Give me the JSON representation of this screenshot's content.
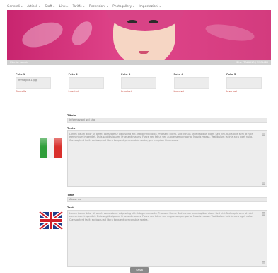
{
  "topnav": {
    "items": [
      {
        "label": "Generali"
      },
      {
        "label": "Articoli"
      },
      {
        "label": "Staff"
      },
      {
        "label": "Link"
      },
      {
        "label": "Tariffe"
      },
      {
        "label": "Recensioni"
      },
      {
        "label": "Photogallery"
      },
      {
        "label": "Impostazioni"
      }
    ]
  },
  "infobar": {
    "left": "Utente: Admin",
    "right": "Sito: ITALIANO / ENGLISH"
  },
  "boxes": [
    {
      "title": "Foto 1",
      "value": "Immagine1.jpg",
      "link": "Cancella"
    },
    {
      "title": "Foto 2",
      "value": "",
      "link": "Inserisci"
    },
    {
      "title": "Foto 3",
      "value": "",
      "link": "Inserisci"
    },
    {
      "title": "Foto 4",
      "value": "",
      "link": "Inserisci"
    },
    {
      "title": "Foto 5",
      "value": "",
      "link": "Inserisci"
    }
  ],
  "italian": {
    "titolo_label": "Titolo",
    "titolo_value": "Informazioni sul sito",
    "testo_label": "Testo",
    "testo_value": "Lorem ipsum dolor sit amet, consectetur adipiscing elit. Integer nec odio. Praesent libero. Sed cursus ante dapibus diam. Sed nisi. Nulla quis sem at nibh elementum imperdiet. Duis sagittis ipsum. Praesent mauris. Fusce nec tellus sed augue semper porta. Mauris massa. Vestibulum lacinia arcu eget nulla. Class aptent taciti sociosqu ad litora torquent per conubia nostra, per inceptos himenaeos."
  },
  "english": {
    "titolo_label": "Title",
    "titolo_value": "About us",
    "testo_label": "Text",
    "testo_value": "Lorem ipsum dolor sit amet, consectetur adipiscing elit. Integer nec odio. Praesent libero. Sed cursus ante dapibus diam. Sed nisi. Nulla quis sem at nibh elementum imperdiet. Duis sagittis ipsum. Praesent mauris. Fusce nec tellus sed augue semper porta. Mauris massa. Vestibulum lacinia arcu eget nulla. Class aptent taciti sociosqu ad litora torquent per conubia nostra."
  },
  "submit_label": "Salva",
  "colors": {
    "banner": "#d33b7e",
    "link": "#c0392b"
  }
}
